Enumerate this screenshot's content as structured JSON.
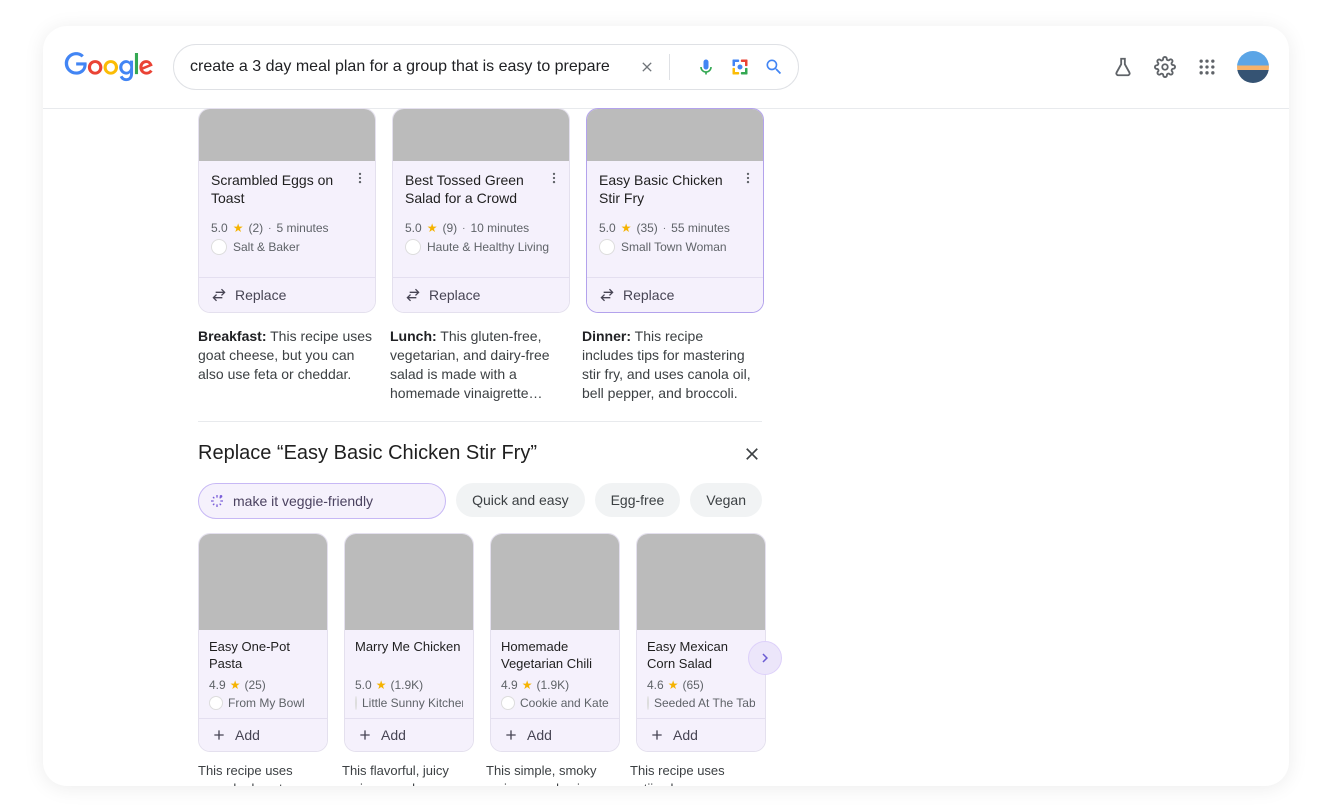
{
  "search": {
    "query": "create a 3 day meal plan for a group that is easy to prepare",
    "clear_icon": "clear-icon",
    "voice_icon": "voice-search-icon",
    "lens_icon": "lens-icon",
    "search_icon": "search-icon"
  },
  "header_icons": {
    "labs": "labs-icon",
    "settings": "settings-icon",
    "apps": "apps-icon",
    "avatar": "avatar"
  },
  "meal_plan": {
    "cards": [
      {
        "image_class": "img-eggs",
        "title": "Scrambled Eggs on Toast",
        "rating": "5.0",
        "reviews": "(2)",
        "time": "5 minutes",
        "source": "Salt & Baker",
        "action": "Replace",
        "meal_label": "Breakfast:",
        "description": "This recipe uses goat cheese, but you can also use feta or cheddar.",
        "selected": false
      },
      {
        "image_class": "img-salad",
        "title": "Best Tossed Green Salad for a Crowd",
        "rating": "5.0",
        "reviews": "(9)",
        "time": "10 minutes",
        "source": "Haute & Healthy Living",
        "action": "Replace",
        "meal_label": "Lunch:",
        "description": "This gluten-free, vegetarian, and dairy-free salad is made with a homemade vinaigrette dressing that can be made ahead of time.",
        "selected": false
      },
      {
        "image_class": "img-stirfry",
        "title": "Easy Basic Chicken Stir Fry",
        "rating": "5.0",
        "reviews": "(35)",
        "time": "55 minutes",
        "source": "Small Town Woman",
        "action": "Replace",
        "meal_label": "Dinner:",
        "description": "This recipe includes tips for mastering stir fry, and uses canola oil, bell pepper, and broccoli.",
        "selected": true
      }
    ]
  },
  "replace_section": {
    "title": "Replace “Easy Basic Chicken Stir Fry”",
    "chips": [
      {
        "label": "make it veggie-friendly",
        "primary": true
      },
      {
        "label": "Quick and easy",
        "primary": false
      },
      {
        "label": "Egg-free",
        "primary": false
      },
      {
        "label": "Vegan",
        "primary": false
      }
    ],
    "cards": [
      {
        "image_class": "img-pasta",
        "title": "Easy One-Pot Pasta",
        "rating": "4.9",
        "reviews": "(25)",
        "source": "From My Bowl",
        "action": "Add",
        "description": "This recipe uses uncooked pasta, vegetables, and broth in one pot."
      },
      {
        "image_class": "img-chicken",
        "title": "Marry Me Chicken",
        "rating": "5.0",
        "reviews": "(1.9K)",
        "source": "Little Sunny Kitchen",
        "action": "Add",
        "description": "This flavorful, juicy recipe uses heavy cream and sun-dried tomatoes."
      },
      {
        "image_class": "img-chili",
        "title": "Homemade Vegetarian Chili",
        "rating": "4.9",
        "reviews": "(1.9K)",
        "source": "Cookie and Kate",
        "action": "Add",
        "description": "This simple, smoky recipe uses basic ingredients and comes together fast."
      },
      {
        "image_class": "img-corn",
        "title": "Easy Mexican Corn Salad",
        "rating": "4.6",
        "reviews": "(65)",
        "source": "Seeded At The Table",
        "action": "Add",
        "description": "This recipe uses cotija cheese, avocado, and lime."
      }
    ]
  }
}
